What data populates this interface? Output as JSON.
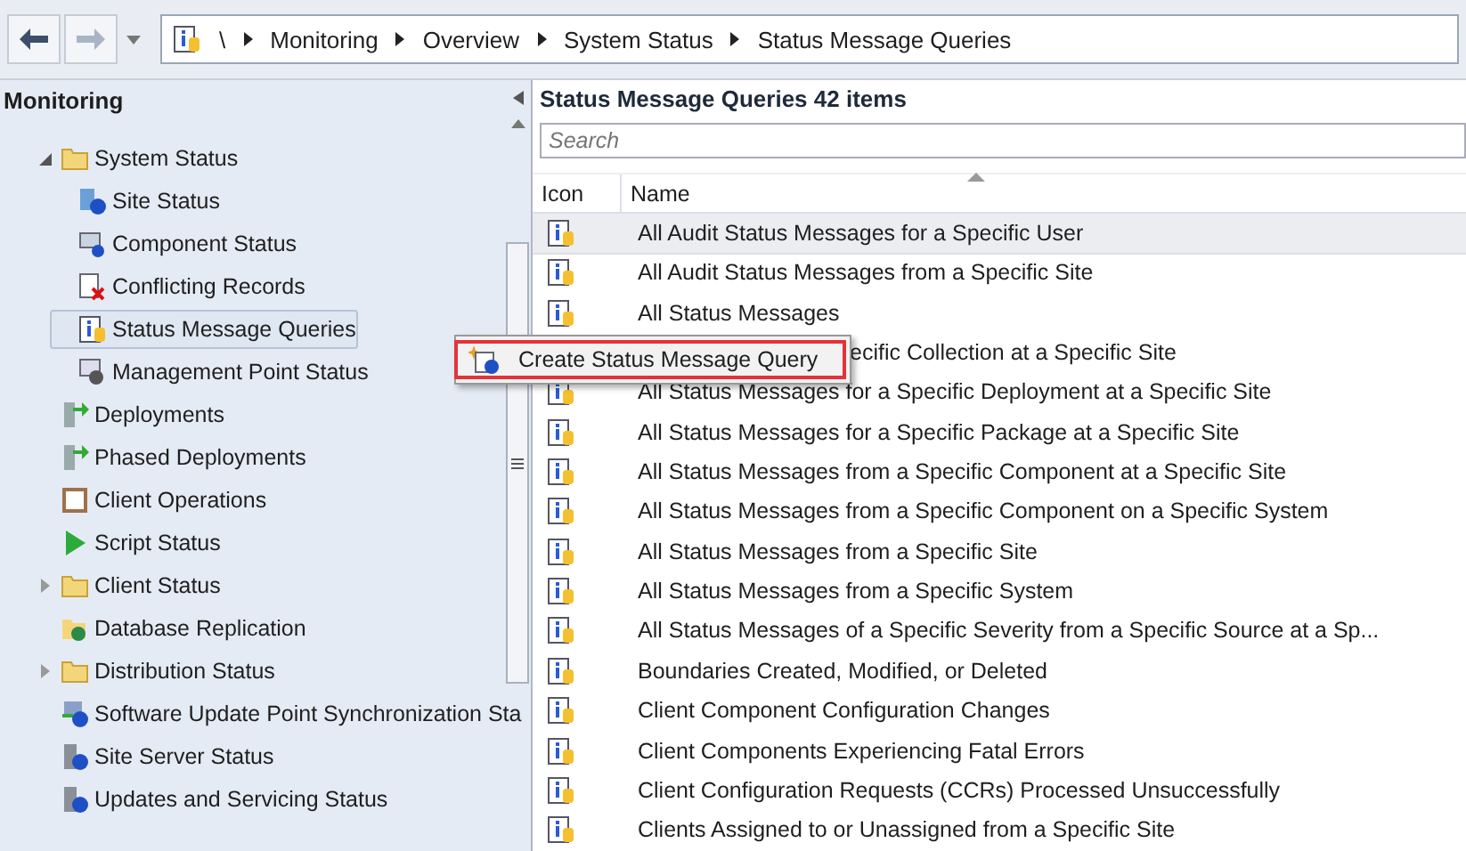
{
  "nav": {
    "back_enabled": true,
    "forward_enabled": false
  },
  "breadcrumb": [
    "\\",
    "Monitoring",
    "Overview",
    "System Status",
    "Status Message Queries"
  ],
  "navigation_pane": {
    "title": "Monitoring",
    "items": [
      {
        "label": "System Status",
        "kind": "folder",
        "expanded": true,
        "selected": false,
        "children": [
          {
            "label": "Site Status",
            "kind": "site",
            "selected": false
          },
          {
            "label": "Component Status",
            "kind": "component",
            "selected": false
          },
          {
            "label": "Conflicting Records",
            "kind": "conflict",
            "selected": false
          },
          {
            "label": "Status Message Queries",
            "kind": "query",
            "selected": true
          },
          {
            "label": "Management Point Status",
            "kind": "mp",
            "selected": false
          }
        ]
      },
      {
        "label": "Deployments",
        "kind": "deploy",
        "selected": false
      },
      {
        "label": "Phased Deployments",
        "kind": "deploy",
        "selected": false
      },
      {
        "label": "Client Operations",
        "kind": "clientops",
        "selected": false
      },
      {
        "label": "Script Status",
        "kind": "script",
        "selected": false
      },
      {
        "label": "Client Status",
        "kind": "folder",
        "expanded": false,
        "selected": false
      },
      {
        "label": "Database Replication",
        "kind": "replication",
        "selected": false
      },
      {
        "label": "Distribution Status",
        "kind": "folder",
        "expanded": false,
        "selected": false
      },
      {
        "label": "Software Update Point Synchronization Sta",
        "kind": "sup",
        "selected": false
      },
      {
        "label": "Site Server Status",
        "kind": "server",
        "selected": false
      },
      {
        "label": "Updates and Servicing Status",
        "kind": "server",
        "selected": false
      }
    ]
  },
  "list": {
    "title": "Status Message Queries 42 items",
    "search": {
      "placeholder": "Search"
    },
    "columns": [
      {
        "label": "Icon"
      },
      {
        "label": "Name",
        "sorted": true
      }
    ],
    "rows": [
      {
        "name": "All Audit Status Messages for a Specific User",
        "selected": true,
        "kind": "plain"
      },
      {
        "name": "All Audit Status Messages from a Specific Site",
        "selected": false,
        "kind": "plain"
      },
      {
        "name": "All Status Messages",
        "selected": false,
        "kind": "plain"
      },
      {
        "name": "ecific Collection at a Specific Site",
        "selected": false,
        "kind": "covered"
      },
      {
        "name": "All Status Messages for a Specific Deployment at a Specific Site",
        "selected": false,
        "kind": "plain"
      },
      {
        "name": "All Status Messages for a Specific Package at a Specific Site",
        "selected": false,
        "kind": "plain"
      },
      {
        "name": "All Status Messages from a Specific Component at a Specific Site",
        "selected": false,
        "kind": "plain"
      },
      {
        "name": "All Status Messages from a Specific Component on a Specific System",
        "selected": false,
        "kind": "plain"
      },
      {
        "name": "All Status Messages from a Specific Site",
        "selected": false,
        "kind": "plain"
      },
      {
        "name": "All Status Messages from a Specific System",
        "selected": false,
        "kind": "plain"
      },
      {
        "name": "All Status Messages of a Specific Severity from a Specific Source at a Sp...",
        "selected": false,
        "kind": "plain"
      },
      {
        "name": "Boundaries Created, Modified, or Deleted",
        "selected": false,
        "kind": "plain"
      },
      {
        "name": "Client Component Configuration Changes",
        "selected": false,
        "kind": "plain"
      },
      {
        "name": "Client Components Experiencing Fatal Errors",
        "selected": false,
        "kind": "plain"
      },
      {
        "name": "Client Configuration Requests (CCRs) Processed Unsuccessfully",
        "selected": false,
        "kind": "plain"
      },
      {
        "name": "Clients Assigned to or Unassigned from a Specific Site",
        "selected": false,
        "kind": "plain"
      }
    ]
  },
  "context_menu": {
    "items": [
      {
        "label": "Create Status Message Query",
        "highlighted": true
      }
    ]
  }
}
